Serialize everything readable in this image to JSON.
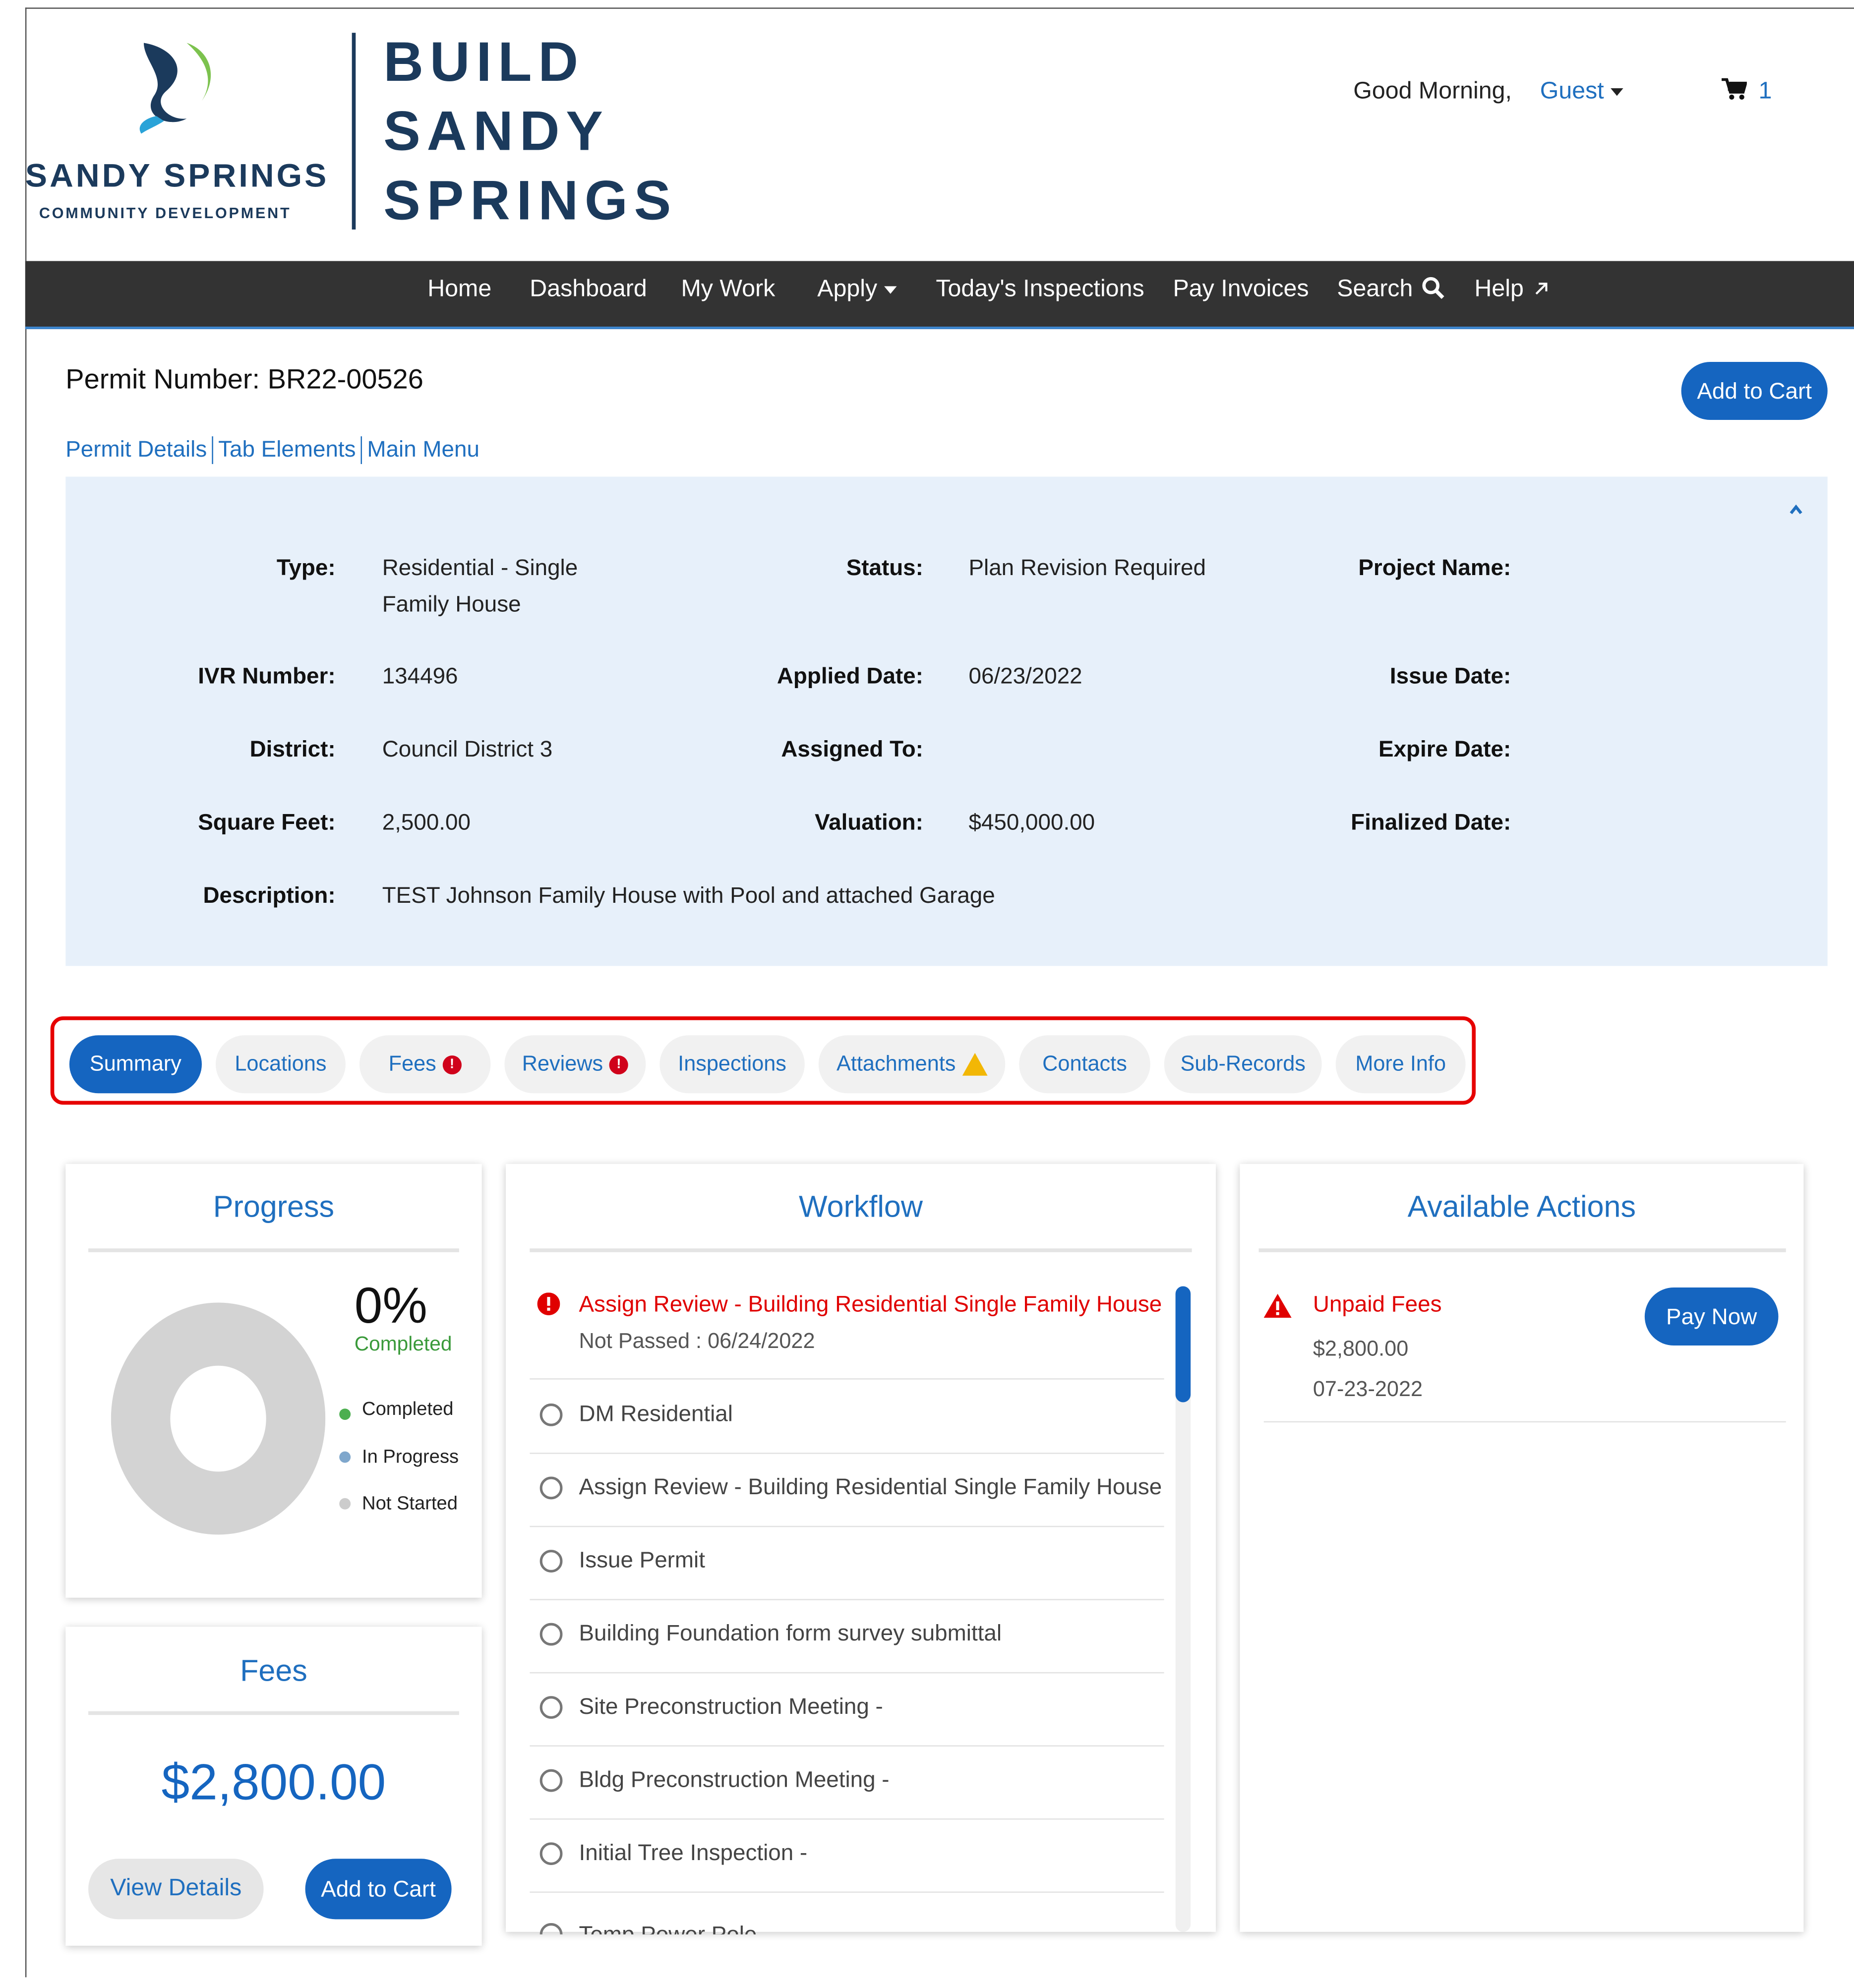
{
  "brand": {
    "logo_word": "SANDY SPRINGS",
    "logo_sub": "COMMUNITY DEVELOPMENT",
    "lines": [
      "BUILD",
      "SANDY",
      "SPRINGS"
    ]
  },
  "header": {
    "greeting": "Good Morning,",
    "user": "Guest",
    "cart_count": "1"
  },
  "nav": {
    "items": [
      "Home",
      "Dashboard",
      "My Work",
      "Apply",
      "Today's Inspections",
      "Pay Invoices",
      "Search",
      "Help"
    ]
  },
  "permit": {
    "title": "Permit Number: BR22-00526",
    "add_to_cart": "Add to Cart",
    "links": [
      "Permit Details",
      "Tab Elements",
      "Main Menu"
    ]
  },
  "details": {
    "type_label": "Type:",
    "type_value_1": "Residential - Single",
    "type_value_2": "Family House",
    "status_label": "Status:",
    "status_value": "Plan Revision Required",
    "project_label": "Project Name:",
    "ivr_label": "IVR Number:",
    "ivr_value": "134496",
    "applied_label": "Applied Date:",
    "applied_value": "06/23/2022",
    "issue_label": "Issue Date:",
    "district_label": "District:",
    "district_value": "Council District 3",
    "assigned_label": "Assigned To:",
    "expire_label": "Expire Date:",
    "sqft_label": "Square Feet:",
    "sqft_value": "2,500.00",
    "valuation_label": "Valuation:",
    "valuation_value": "$450,000.00",
    "finalized_label": "Finalized Date:",
    "description_label": "Description:",
    "description_value": "TEST Johnson Family House with Pool and attached Garage"
  },
  "tabs": [
    "Summary",
    "Locations",
    "Fees",
    "Reviews",
    "Inspections",
    "Attachments",
    "Contacts",
    "Sub-Records",
    "More Info"
  ],
  "progress": {
    "title": "Progress",
    "percent": "0%",
    "percent_caption": "Completed",
    "legend": [
      "Completed",
      "In Progress",
      "Not Started"
    ],
    "colors": {
      "completed": "#4caf50",
      "in_progress": "#7fa7cc",
      "not_started": "#cccccc"
    }
  },
  "fees_card": {
    "title": "Fees",
    "amount": "$2,800.00",
    "view_details": "View Details",
    "add_to_cart": "Add to Cart"
  },
  "workflow": {
    "title": "Workflow",
    "first_item": "Assign Review - Building Residential Single Family House -",
    "first_item_sub": "Not Passed : 06/24/2022",
    "items": [
      "DM Residential",
      "Assign Review - Building Residential Single Family House",
      "Issue Permit",
      "Building Foundation form survey submittal",
      "Site Preconstruction Meeting -",
      "Bldg Preconstruction Meeting -",
      "Initial Tree Inspection -",
      "Temp Power Pole -"
    ]
  },
  "actions": {
    "title": "Available Actions",
    "item_title": "Unpaid Fees",
    "item_amount": "$2,800.00",
    "item_date": "07-23-2022",
    "pay_now": "Pay Now"
  },
  "colors": {
    "primary": "#1565c0",
    "link": "#1f6fbf",
    "nav_bg": "#333333",
    "alert": "#e60000",
    "panel_bg": "#e7f0fa"
  }
}
